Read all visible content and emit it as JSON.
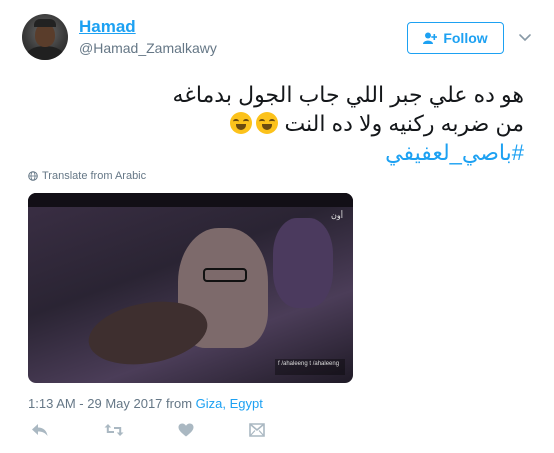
{
  "user": {
    "display_name": "Hamad",
    "username": "@Hamad_Zamalkawy"
  },
  "follow": {
    "label": "Follow"
  },
  "tweet": {
    "line1": "هو ده علي جبر اللي جاب الجول بدماغه",
    "line2": "من ضربه ركنيه ولا ده النت",
    "hashtag": "#باصي_لعفيفي"
  },
  "translate": {
    "label": "Translate from Arabic"
  },
  "media": {
    "channel_logo": "أون",
    "credits": "f /ahaleeng  t /ahaleeng"
  },
  "meta": {
    "time": "1:13 AM - 29 May 2017 from ",
    "location": "Giza, Egypt"
  },
  "icons": {
    "reply": "reply-icon",
    "retweet": "retweet-icon",
    "like": "heart-icon",
    "dm": "direct-message-icon"
  },
  "colors": {
    "accent": "#1da1f2",
    "secondary_text": "#657786",
    "action_icons": "#aab8c2"
  }
}
